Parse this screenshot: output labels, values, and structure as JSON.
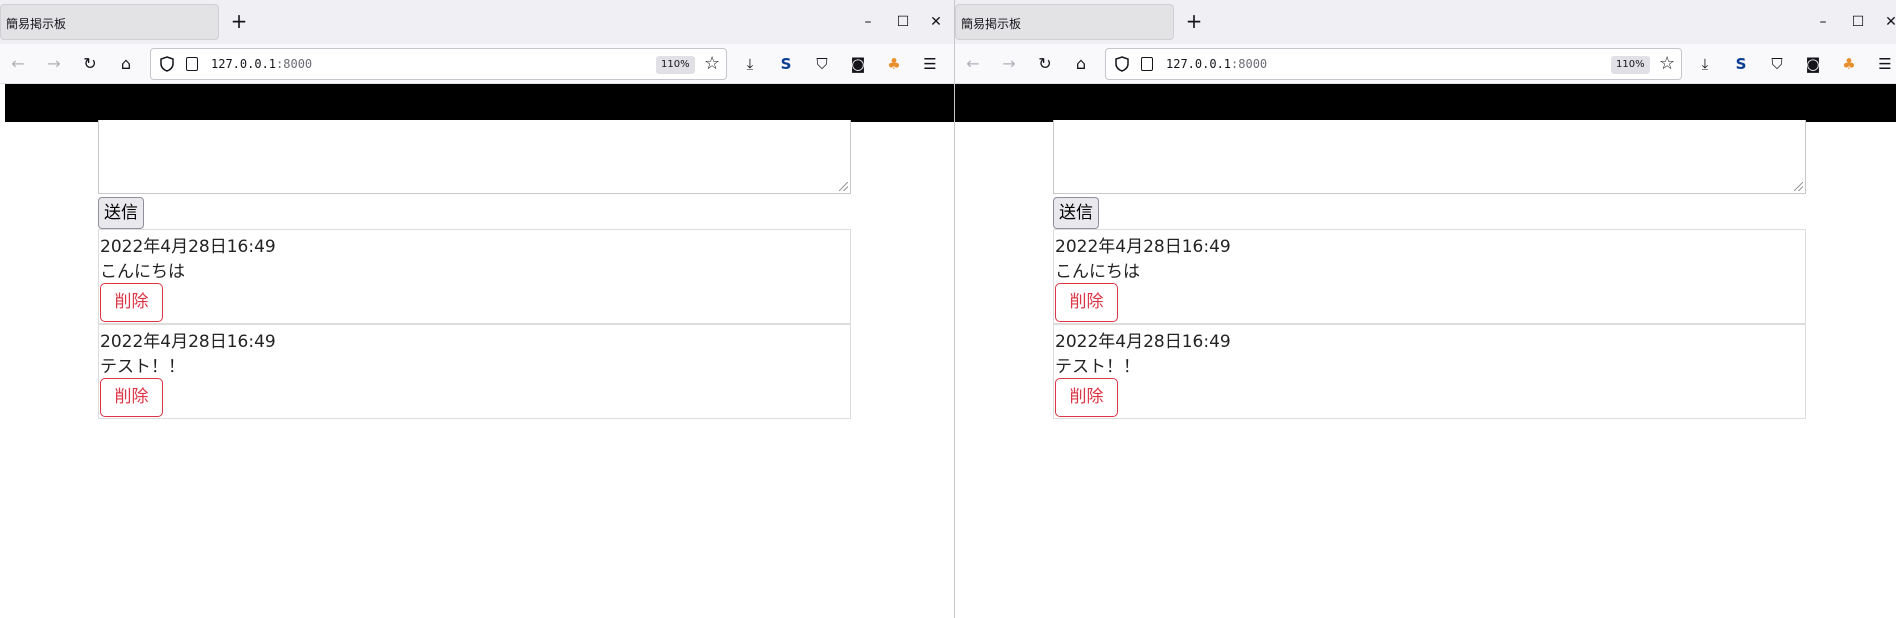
{
  "windows": [
    {
      "tab_title": "簡易掲示板",
      "new_tab_symbol": "+",
      "controls": {
        "minimize": "–",
        "maximize": "☐",
        "close": "✕"
      },
      "url": {
        "host": "127.0.0.1",
        "port": ":8000"
      },
      "zoom": "110%",
      "form": {
        "submit_label": "送信"
      },
      "posts": [
        {
          "date": "2022年4月28日16:49",
          "content": "こんにちは",
          "delete_label": "削除"
        },
        {
          "date": "2022年4月28日16:49",
          "content": "テスト！！",
          "delete_label": "削除"
        }
      ]
    },
    {
      "tab_title": "簡易掲示板",
      "new_tab_symbol": "+",
      "controls": {
        "minimize": "–",
        "maximize": "☐",
        "close": "✕"
      },
      "url": {
        "host": "127.0.0.1",
        "port": ":8000"
      },
      "zoom": "110%",
      "form": {
        "submit_label": "送信"
      },
      "posts": [
        {
          "date": "2022年4月28日16:49",
          "content": "こんにちは",
          "delete_label": "削除"
        },
        {
          "date": "2022年4月28日16:49",
          "content": "テスト！！",
          "delete_label": "削除"
        }
      ]
    }
  ],
  "icons": {
    "back": "back-arrow-icon",
    "forward": "forward-arrow-icon",
    "reload": "reload-icon",
    "home": "home-icon",
    "shield": "tracking-shield-icon",
    "page": "page-icon",
    "bookmark": "star-icon",
    "download": "download-icon",
    "s_ext": "s-extension-icon",
    "ublock": "ublock-icon",
    "ext2": "glasses-extension-icon",
    "ext3": "puzzle-extension-icon",
    "menu": "hamburger-menu-icon"
  },
  "colors": {
    "danger": "#dc3545",
    "tabbar_bg": "#f0f0f4",
    "black_banner": "#000000"
  }
}
